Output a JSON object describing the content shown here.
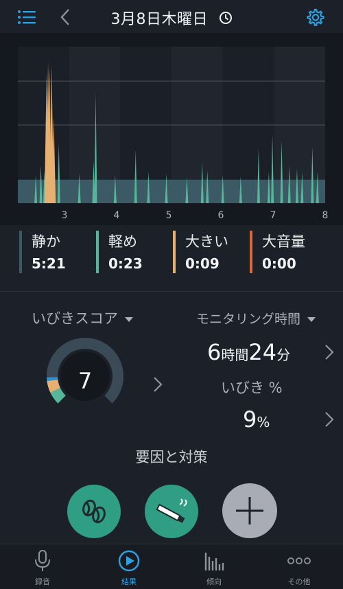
{
  "header": {
    "title": "3月8日木曜日",
    "menu_icon": "list-icon",
    "back_icon": "chevron-left-icon",
    "clock_icon": "clock-icon",
    "settings_icon": "gear-icon"
  },
  "chart_data": {
    "type": "bar",
    "x_ticks": [
      "3",
      "4",
      "5",
      "6",
      "7",
      "8"
    ],
    "series": [
      {
        "name": "静か",
        "color": "#3c5a65"
      },
      {
        "name": "軽め",
        "color": "#57b59a"
      },
      {
        "name": "大きい",
        "color": "#e6b072"
      },
      {
        "name": "大音量",
        "color": "#d9693a"
      }
    ],
    "ylim": [
      0,
      1
    ],
    "grid": true,
    "baseline_level": 0.15,
    "spikes": [
      {
        "x": 2.35,
        "v": 0.18,
        "s": 1
      },
      {
        "x": 2.45,
        "v": 0.24,
        "s": 1
      },
      {
        "x": 2.52,
        "v": 0.21,
        "s": 1
      },
      {
        "x": 2.56,
        "v": 0.82,
        "s": 2
      },
      {
        "x": 2.59,
        "v": 0.9,
        "s": 2
      },
      {
        "x": 2.62,
        "v": 0.86,
        "s": 2
      },
      {
        "x": 2.66,
        "v": 0.88,
        "s": 2
      },
      {
        "x": 2.7,
        "v": 0.55,
        "s": 2
      },
      {
        "x": 2.8,
        "v": 0.38,
        "s": 1
      },
      {
        "x": 3.2,
        "v": 0.19,
        "s": 1
      },
      {
        "x": 3.48,
        "v": 0.27,
        "s": 1
      },
      {
        "x": 3.52,
        "v": 0.7,
        "s": 1
      },
      {
        "x": 3.9,
        "v": 0.18,
        "s": 1
      },
      {
        "x": 4.3,
        "v": 0.34,
        "s": 1
      },
      {
        "x": 4.55,
        "v": 0.2,
        "s": 1
      },
      {
        "x": 4.9,
        "v": 0.19,
        "s": 1
      },
      {
        "x": 5.3,
        "v": 0.17,
        "s": 1
      },
      {
        "x": 5.6,
        "v": 0.26,
        "s": 1
      },
      {
        "x": 5.7,
        "v": 0.21,
        "s": 1
      },
      {
        "x": 6.0,
        "v": 0.18,
        "s": 1
      },
      {
        "x": 6.35,
        "v": 0.17,
        "s": 1
      },
      {
        "x": 6.7,
        "v": 0.35,
        "s": 1
      },
      {
        "x": 6.9,
        "v": 0.2,
        "s": 1
      },
      {
        "x": 6.97,
        "v": 0.44,
        "s": 1
      },
      {
        "x": 7.15,
        "v": 0.4,
        "s": 1
      },
      {
        "x": 7.3,
        "v": 0.24,
        "s": 1
      },
      {
        "x": 7.45,
        "v": 0.22,
        "s": 1
      },
      {
        "x": 7.55,
        "v": 0.2,
        "s": 1
      },
      {
        "x": 7.75,
        "v": 0.36,
        "s": 1
      },
      {
        "x": 7.85,
        "v": 0.2,
        "s": 1
      }
    ]
  },
  "legend": [
    {
      "name": "静か",
      "value": "5:21",
      "color": "#3c5a65"
    },
    {
      "name": "軽め",
      "value": "0:23",
      "color": "#57b59a"
    },
    {
      "name": "大きい",
      "value": "0:09",
      "color": "#e6b072"
    },
    {
      "name": "大音量",
      "value": "0:00",
      "color": "#d9693a"
    }
  ],
  "score": {
    "title": "いびきスコア",
    "value": "7",
    "max": 100,
    "segments": [
      {
        "fraction": 0.055,
        "color": "#57b59a"
      },
      {
        "fraction": 0.05,
        "color": "#e6b072"
      },
      {
        "fraction": 0.015,
        "color": "#2f8fcf"
      }
    ]
  },
  "monitoring": {
    "title": "モニタリング時間",
    "hours": "6",
    "hours_unit": "時間",
    "minutes": "24",
    "minutes_unit": "分"
  },
  "snore_pct": {
    "label": "いびき %",
    "value": "9",
    "unit": "%"
  },
  "factors": {
    "title": "要因と対策",
    "items": [
      "coffee-beans-icon",
      "cigarette-icon",
      "plus-icon"
    ]
  },
  "tabs": [
    {
      "label": "録音",
      "icon": "microphone-icon"
    },
    {
      "label": "結果",
      "icon": "play-circle-icon"
    },
    {
      "label": "傾向",
      "icon": "bar-chart-icon"
    },
    {
      "label": "その他",
      "icon": "more-dots-icon"
    }
  ],
  "colors": {
    "background": "#1c2129",
    "accent": "#2fa0e0",
    "chart_background": "#15191f"
  }
}
